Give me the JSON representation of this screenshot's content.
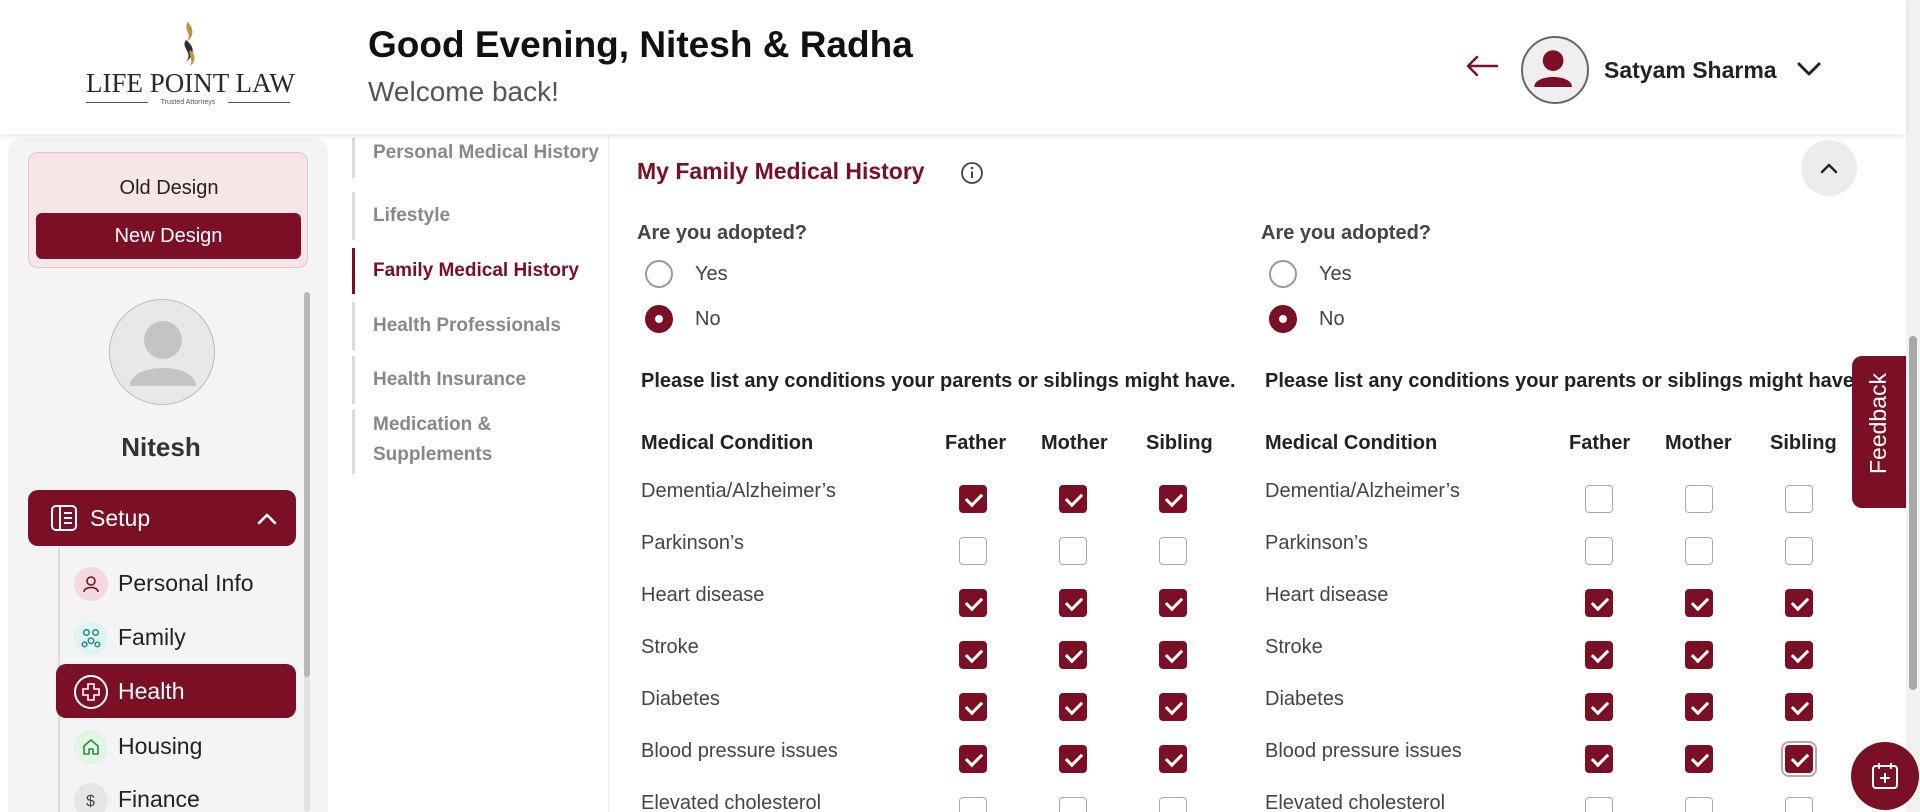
{
  "header": {
    "logo_text": "LIFE POINT LAW",
    "logo_tagline": "Trusted Attorneys",
    "greeting": "Good Evening, Nitesh & Radha",
    "subtitle": "Welcome back!",
    "user_name": "Satyam Sharma"
  },
  "sidebar": {
    "old_design": "Old Design",
    "new_design": "New Design",
    "profile_name": "Nitesh",
    "setup_label": "Setup",
    "items": [
      {
        "label": "Personal Info",
        "icon": "person-icon",
        "active": false
      },
      {
        "label": "Family",
        "icon": "family-icon",
        "active": false
      },
      {
        "label": "Health",
        "icon": "health-cross-icon",
        "active": true
      },
      {
        "label": "Housing",
        "icon": "home-icon",
        "active": false
      },
      {
        "label": "Finance",
        "icon": "dollar-icon",
        "active": false
      }
    ]
  },
  "section_nav": [
    {
      "label": "Personal Medical History",
      "active": false
    },
    {
      "label": "Lifestyle",
      "active": false
    },
    {
      "label": "Family Medical History",
      "active": true
    },
    {
      "label": "Health Professionals",
      "active": false
    },
    {
      "label": "Health Insurance",
      "active": false
    },
    {
      "label": "Medication & Supplements",
      "active": false
    }
  ],
  "main": {
    "title": "My Family Medical History",
    "adopted_question": "Are you adopted?",
    "yes_label": "Yes",
    "no_label": "No",
    "list_question": "Please list any conditions your parents or siblings might have.",
    "col_condition": "Medical Condition",
    "col_father": "Father",
    "col_mother": "Mother",
    "col_sibling": "Sibling",
    "conditions": [
      "Dementia/Alzheimer’s",
      "Parkinson’s",
      "Heart disease",
      "Stroke",
      "Diabetes",
      "Blood pressure issues",
      "Elevated cholesterol"
    ],
    "left": {
      "adopted": "No",
      "checks": [
        [
          true,
          true,
          true
        ],
        [
          false,
          false,
          false
        ],
        [
          true,
          true,
          true
        ],
        [
          true,
          true,
          true
        ],
        [
          true,
          true,
          true
        ],
        [
          true,
          true,
          true
        ],
        [
          false,
          false,
          false
        ]
      ]
    },
    "right": {
      "adopted": "No",
      "checks": [
        [
          false,
          false,
          false
        ],
        [
          false,
          false,
          false
        ],
        [
          true,
          true,
          true
        ],
        [
          true,
          true,
          true
        ],
        [
          true,
          true,
          true
        ],
        [
          true,
          true,
          true
        ],
        [
          false,
          false,
          false
        ]
      ]
    }
  },
  "feedback_label": "Feedback",
  "colors": {
    "brand": "#7b0f26",
    "muted": "#888888"
  }
}
